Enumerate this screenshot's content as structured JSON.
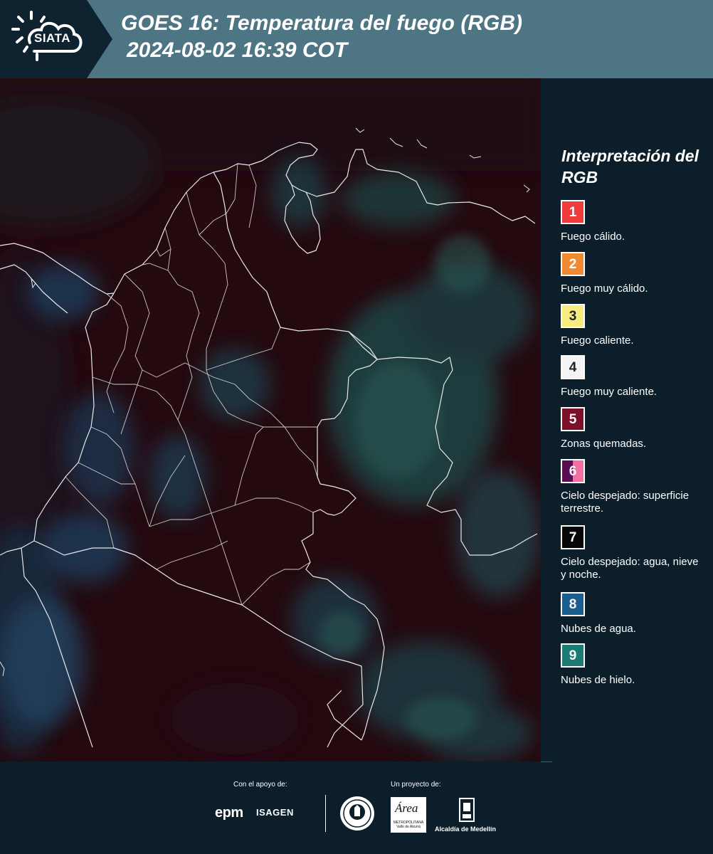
{
  "header": {
    "logo_text": "SIATA",
    "title_line1": "GOES 16: Temperatura del fuego (RGB)",
    "title_line2": "2024-08-02 16:39 COT",
    "background_color": "#4e7584",
    "logo_background": "#0e2230"
  },
  "map": {
    "background_color": "#24090f",
    "border_color": "#e8e8e8",
    "cloud_colors": [
      "#1c4a48",
      "#1f3d5c",
      "#2c5a55"
    ]
  },
  "legend": {
    "title": "Interpretación del RGB",
    "items": [
      {
        "number": "1",
        "label": "Fuego cálido.",
        "color": "#ef3b3b"
      },
      {
        "number": "2",
        "label": "Fuego muy cálido.",
        "color": "#f08a30"
      },
      {
        "number": "3",
        "label": "Fuego caliente.",
        "color": "#f7ec7e"
      },
      {
        "number": "4",
        "label": "Fuego muy caliente.",
        "color": "#f4f4f4"
      },
      {
        "number": "5",
        "label": "Zonas quemadas.",
        "color": "#7c1028"
      },
      {
        "number": "6",
        "label": "Cielo despejado: superficie terrestre.",
        "color": "#5b0c52",
        "color2": "#f26fa0"
      },
      {
        "number": "7",
        "label": "Cielo despejado: agua, nieve y noche.",
        "color": "#060606"
      },
      {
        "number": "8",
        "label": "Nubes de agua.",
        "color": "#1a5e8e"
      },
      {
        "number": "9",
        "label": "Nubes de hielo.",
        "color": "#1a7b74"
      }
    ]
  },
  "footer": {
    "support_caption": "Con el apoyo de:",
    "project_caption": "Un proyecto de:",
    "sponsor1": "epm",
    "sponsor2": "ISAGEN",
    "area_logo_text": "Área",
    "area_logo_subtext": "METROPOLITANA Valle de Aburrá",
    "alcaldia": "Alcaldía de Medellín"
  }
}
